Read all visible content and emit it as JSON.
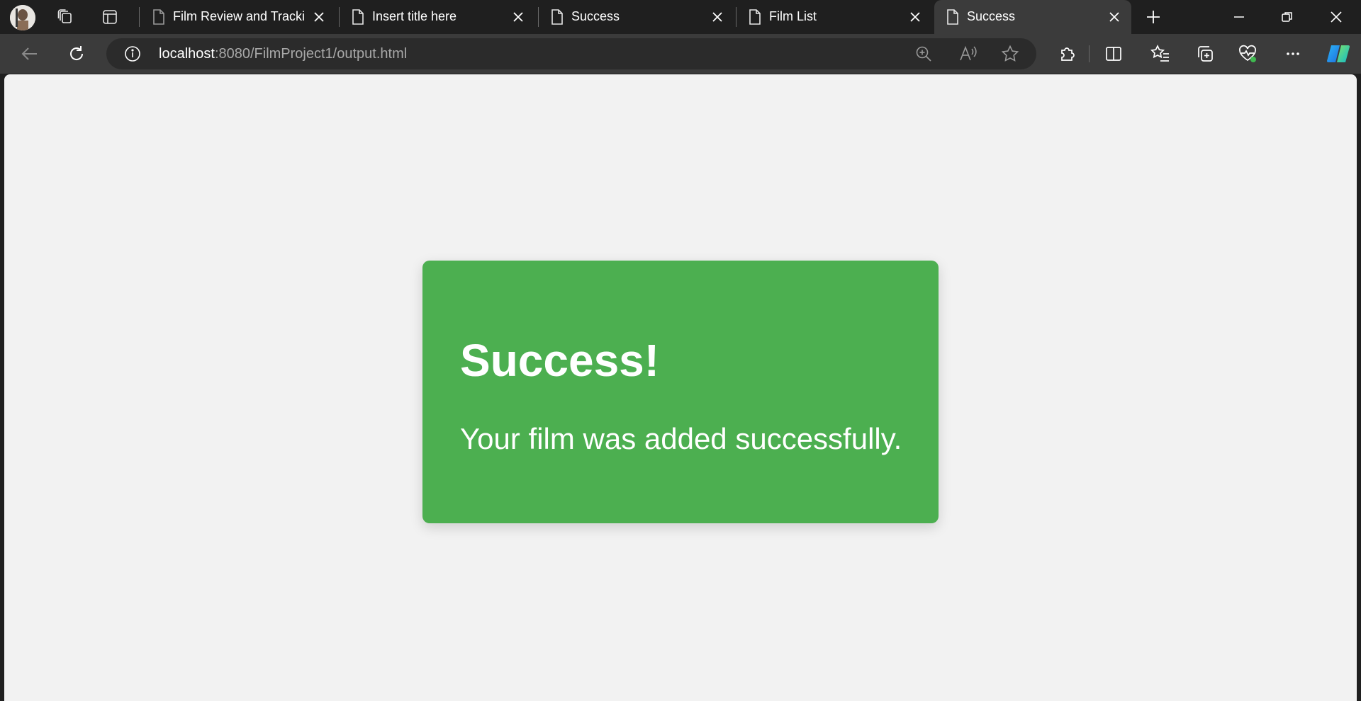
{
  "browser": {
    "tabs": [
      {
        "title": "Film Review and Tracking"
      },
      {
        "title": "Insert title here"
      },
      {
        "title": "Success"
      },
      {
        "title": "Film List"
      },
      {
        "title": "Success"
      }
    ],
    "address_bar": {
      "host": "localhost",
      "path": ":8080/FilmProject1/output.html"
    },
    "icons": {
      "profile": "profile-avatar",
      "workspaces": "workspaces-icon",
      "tab_actions": "tab-actions-icon",
      "new_tab": "plus-icon",
      "back": "back-arrow-icon",
      "refresh": "refresh-icon",
      "site_info": "info-icon",
      "zoom": "zoom-icon",
      "read_aloud": "read-aloud-icon",
      "favorite": "star-icon",
      "extensions": "puzzle-icon",
      "split_screen": "split-screen-icon",
      "favorites_list": "favorites-icon",
      "collections": "collections-icon",
      "browser_essentials": "heart-pulse-icon",
      "more": "more-icon",
      "copilot": "copilot-icon"
    }
  },
  "page": {
    "heading": "Success!",
    "message": "Your film was added successfully.",
    "colors": {
      "background": "#f2f2f2",
      "card": "#4caf50",
      "text": "#ffffff"
    }
  }
}
